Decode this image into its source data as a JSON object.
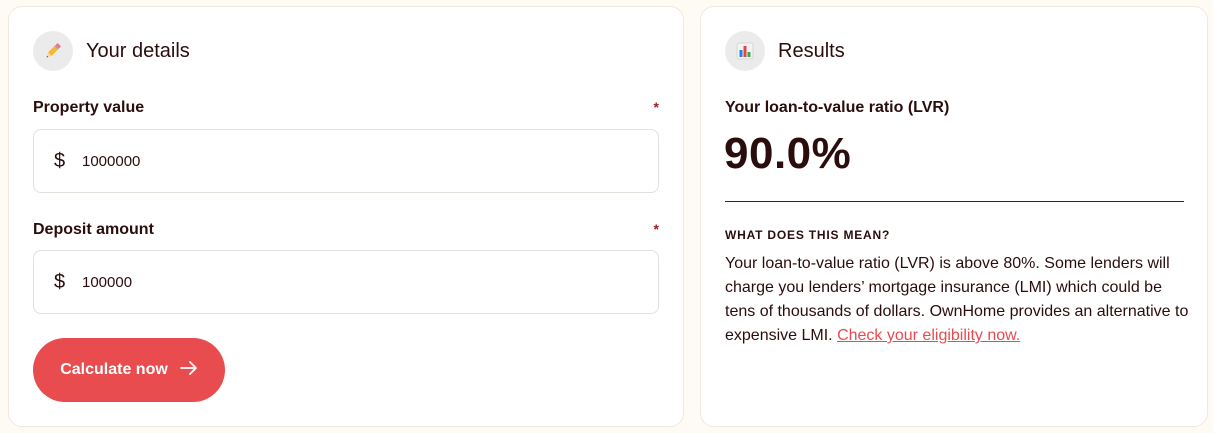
{
  "details": {
    "title": "Your details",
    "icon": "pencil-icon",
    "property": {
      "label": "Property value",
      "required": "*",
      "currency": "$",
      "value": "1000000"
    },
    "deposit": {
      "label": "Deposit amount",
      "required": "*",
      "currency": "$",
      "value": "100000"
    },
    "calculate_label": "Calculate now",
    "calculate_icon": "arrow-right-icon"
  },
  "results": {
    "title": "Results",
    "icon": "bar-chart-icon",
    "lvr_label": "Your loan-to-value ratio (LVR)",
    "lvr_value": "90.0%",
    "meaning_heading": "WHAT DOES THIS MEAN?",
    "meaning_text": "Your loan-to-value ratio (LVR) is above 80%. Some lenders will charge you lenders’ mortgage insurance (LMI) which could be tens of thousands of dollars. OwnHome provides an alternative to expensive LMI. ",
    "link_text": "Check your eligibility now."
  },
  "colors": {
    "accent": "#e84c4f",
    "text": "#2b0d0d",
    "required": "#a31d1d",
    "background": "#fdfbf3"
  }
}
